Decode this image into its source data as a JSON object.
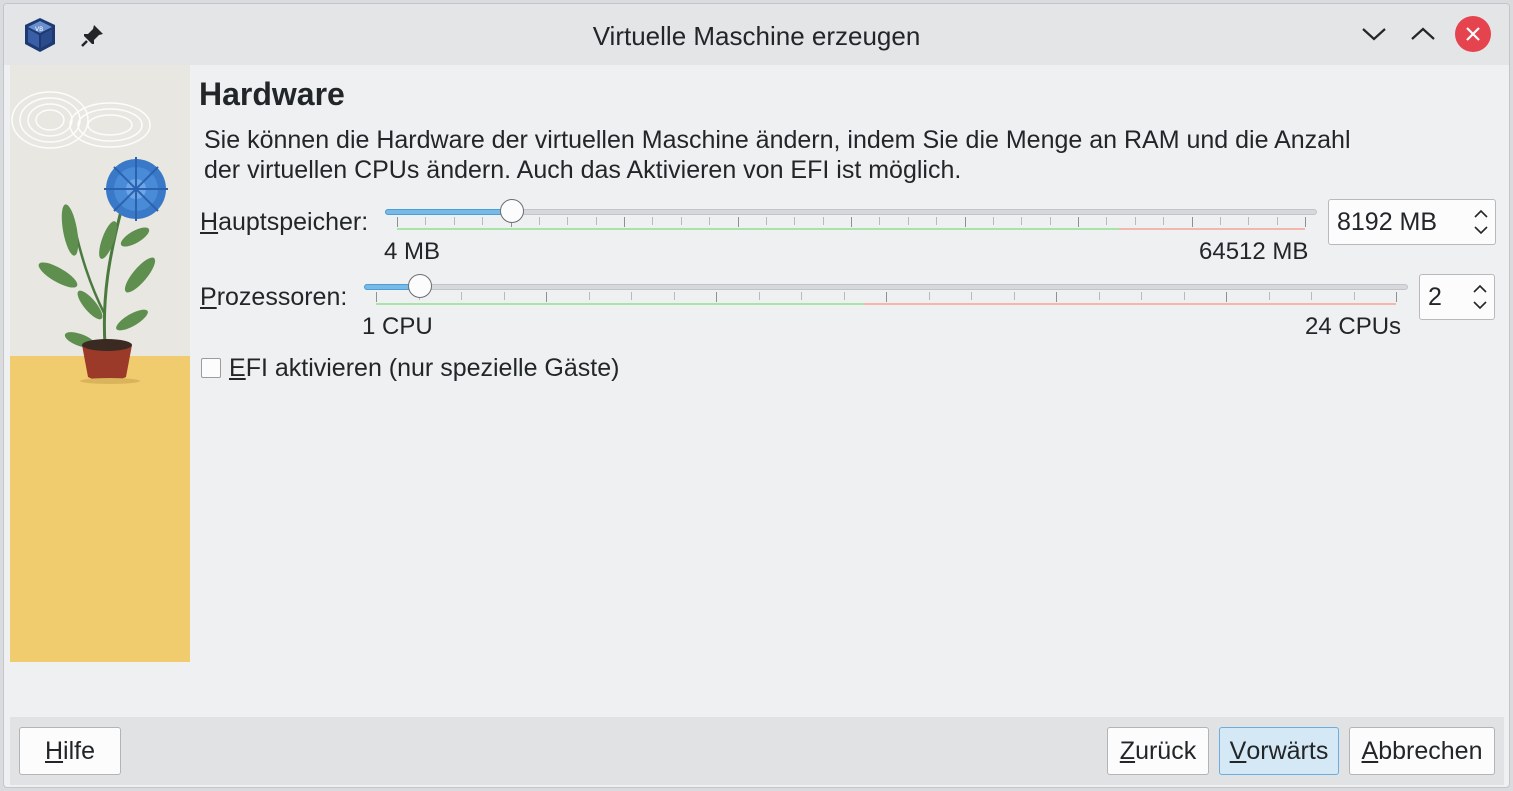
{
  "window": {
    "title": "Virtuelle Maschine erzeugen"
  },
  "page": {
    "heading": "Hardware",
    "description": "Sie können die Hardware der virtuellen Maschine ändern, indem Sie die Menge an RAM und die Anzahl der virtuellen CPUs ändern. Auch das Aktivieren von EFI ist möglich."
  },
  "memory": {
    "label_mnemonic": "H",
    "label_rest": "auptspeicher:",
    "min_label": "4 MB",
    "max_label": "64512 MB",
    "value": "8192 MB",
    "value_fraction": 0.127
  },
  "processors": {
    "label_mnemonic": "P",
    "label_rest": "rozessoren:",
    "min_label": "1 CPU",
    "max_label": "24 CPUs",
    "value": "2",
    "value_fraction": 0.0435
  },
  "efi": {
    "label_mnemonic": "E",
    "label_rest": "FI aktivieren (nur spezielle Gäste)",
    "checked": false
  },
  "buttons": {
    "help_mnemonic": "H",
    "help_rest": "ilfe",
    "back_mnemonic": "Z",
    "back_rest": "urück",
    "next_mnemonic": "V",
    "next_rest": "orwärts",
    "cancel_mnemonic": "A",
    "cancel_rest": "bbrechen"
  },
  "icons": {
    "app": "virtualbox-icon",
    "pin": "pin-icon",
    "minimize": "chevron-down-icon",
    "maximize": "chevron-up-icon",
    "close": "close-icon"
  },
  "colors": {
    "accent": "#4a9fd8",
    "close": "#e5434d",
    "primary_button": "#d5e8f5"
  }
}
